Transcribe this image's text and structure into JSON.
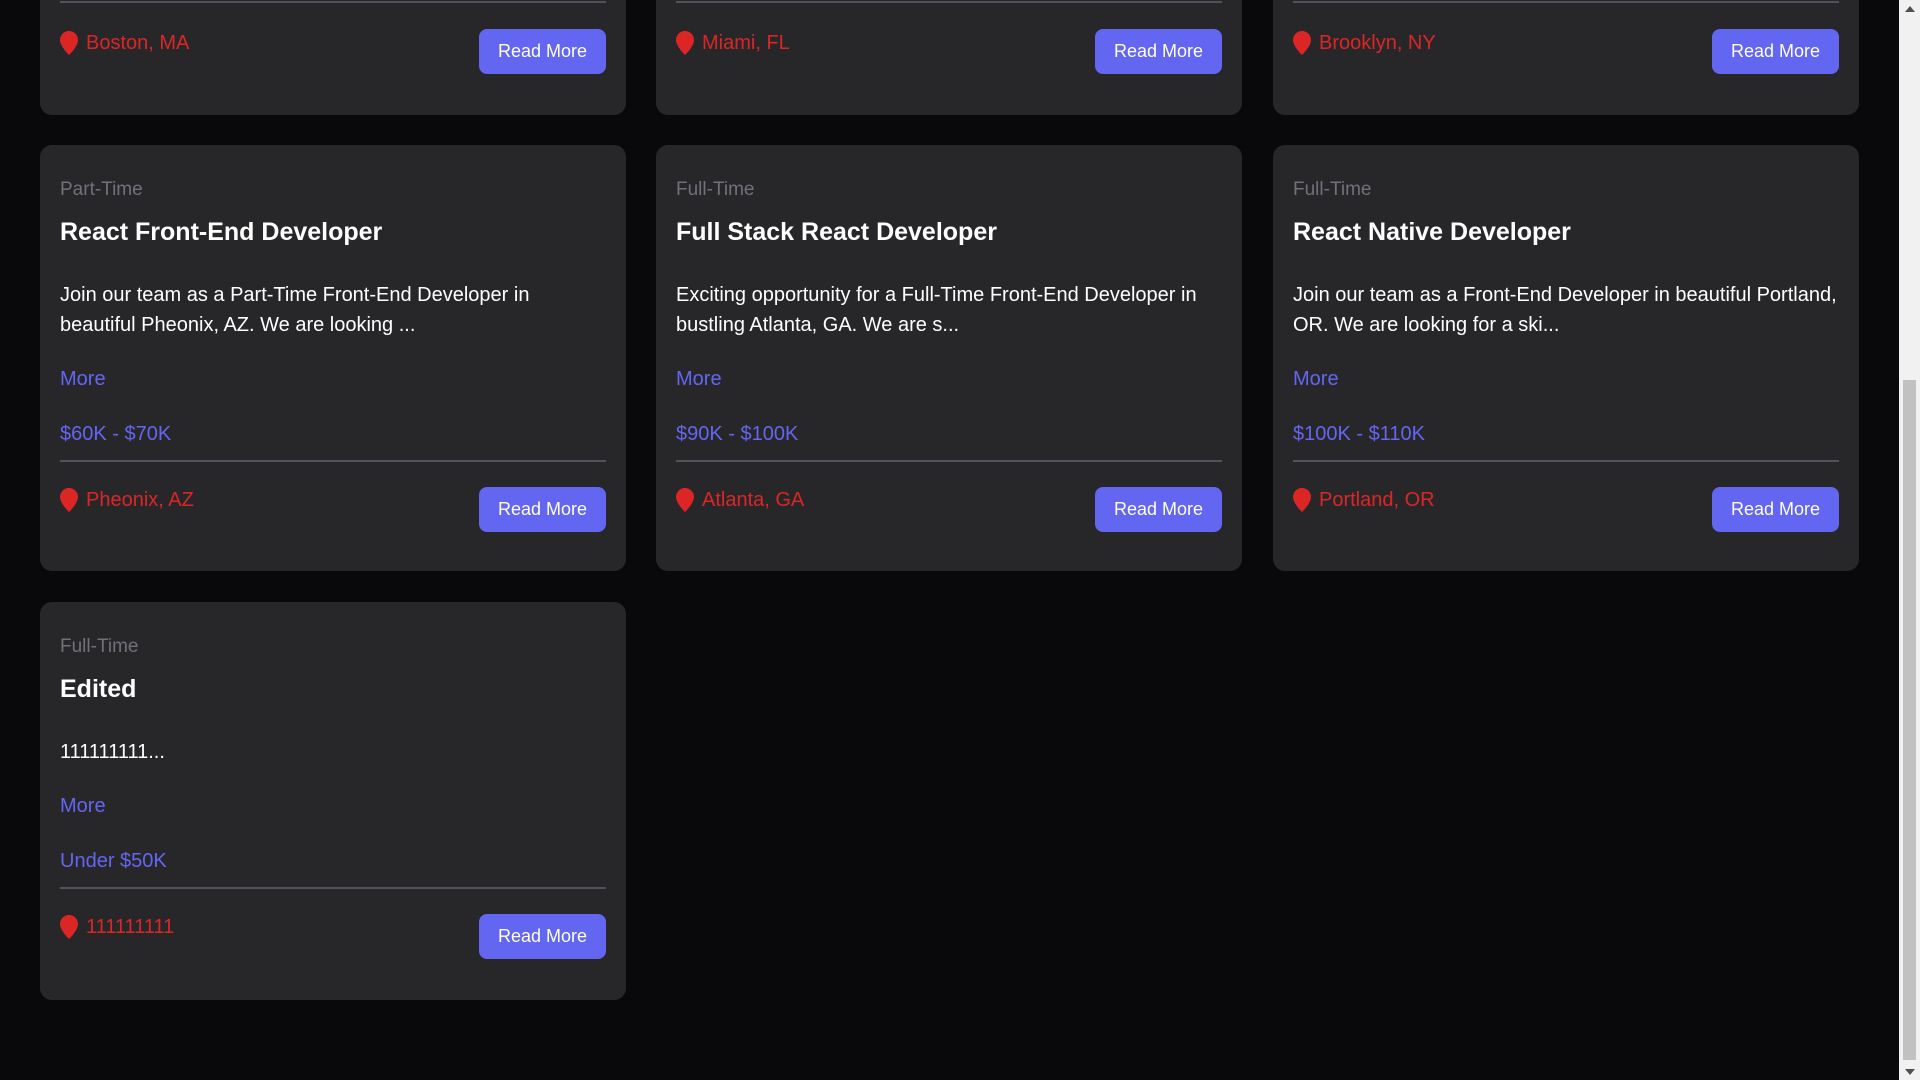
{
  "colors": {
    "page_bg": "#09090b",
    "card_bg": "#27272a",
    "accent": "#6366f1",
    "location": "#dc2626",
    "muted": "#71717a"
  },
  "jobs_top_row": [
    {
      "location": "Boston, MA",
      "button": "Read More"
    },
    {
      "location": "Miami, FL",
      "button": "Read More"
    },
    {
      "location": "Brooklyn, NY",
      "button": "Read More"
    }
  ],
  "jobs": [
    {
      "type": "Part-Time",
      "title": "React Front-End Developer",
      "description": "Join our team as a Part-Time Front-End Developer in beautiful Pheonix, AZ. We are looking ...",
      "more": "More",
      "salary": "$60K - $70K",
      "location": "Pheonix, AZ",
      "button": "Read More"
    },
    {
      "type": "Full-Time",
      "title": "Full Stack React Developer",
      "description": "Exciting opportunity for a Full-Time Front-End Developer in bustling Atlanta, GA. We are s...",
      "more": "More",
      "salary": "$90K - $100K",
      "location": "Atlanta, GA",
      "button": "Read More"
    },
    {
      "type": "Full-Time",
      "title": "React Native Developer",
      "description": "Join our team as a Front-End Developer in beautiful Portland, OR. We are looking for a ski...",
      "more": "More",
      "salary": "$100K - $110K",
      "location": "Portland, OR",
      "button": "Read More"
    },
    {
      "type": "Full-Time",
      "title": "Edited",
      "description": "111111111...",
      "more": "More",
      "salary": "Under $50K",
      "location": "111111111",
      "button": "Read More"
    }
  ],
  "icons": {
    "location": "map-pin-icon",
    "scroll_up": "arrow-up-icon",
    "scroll_down": "arrow-down-icon"
  }
}
